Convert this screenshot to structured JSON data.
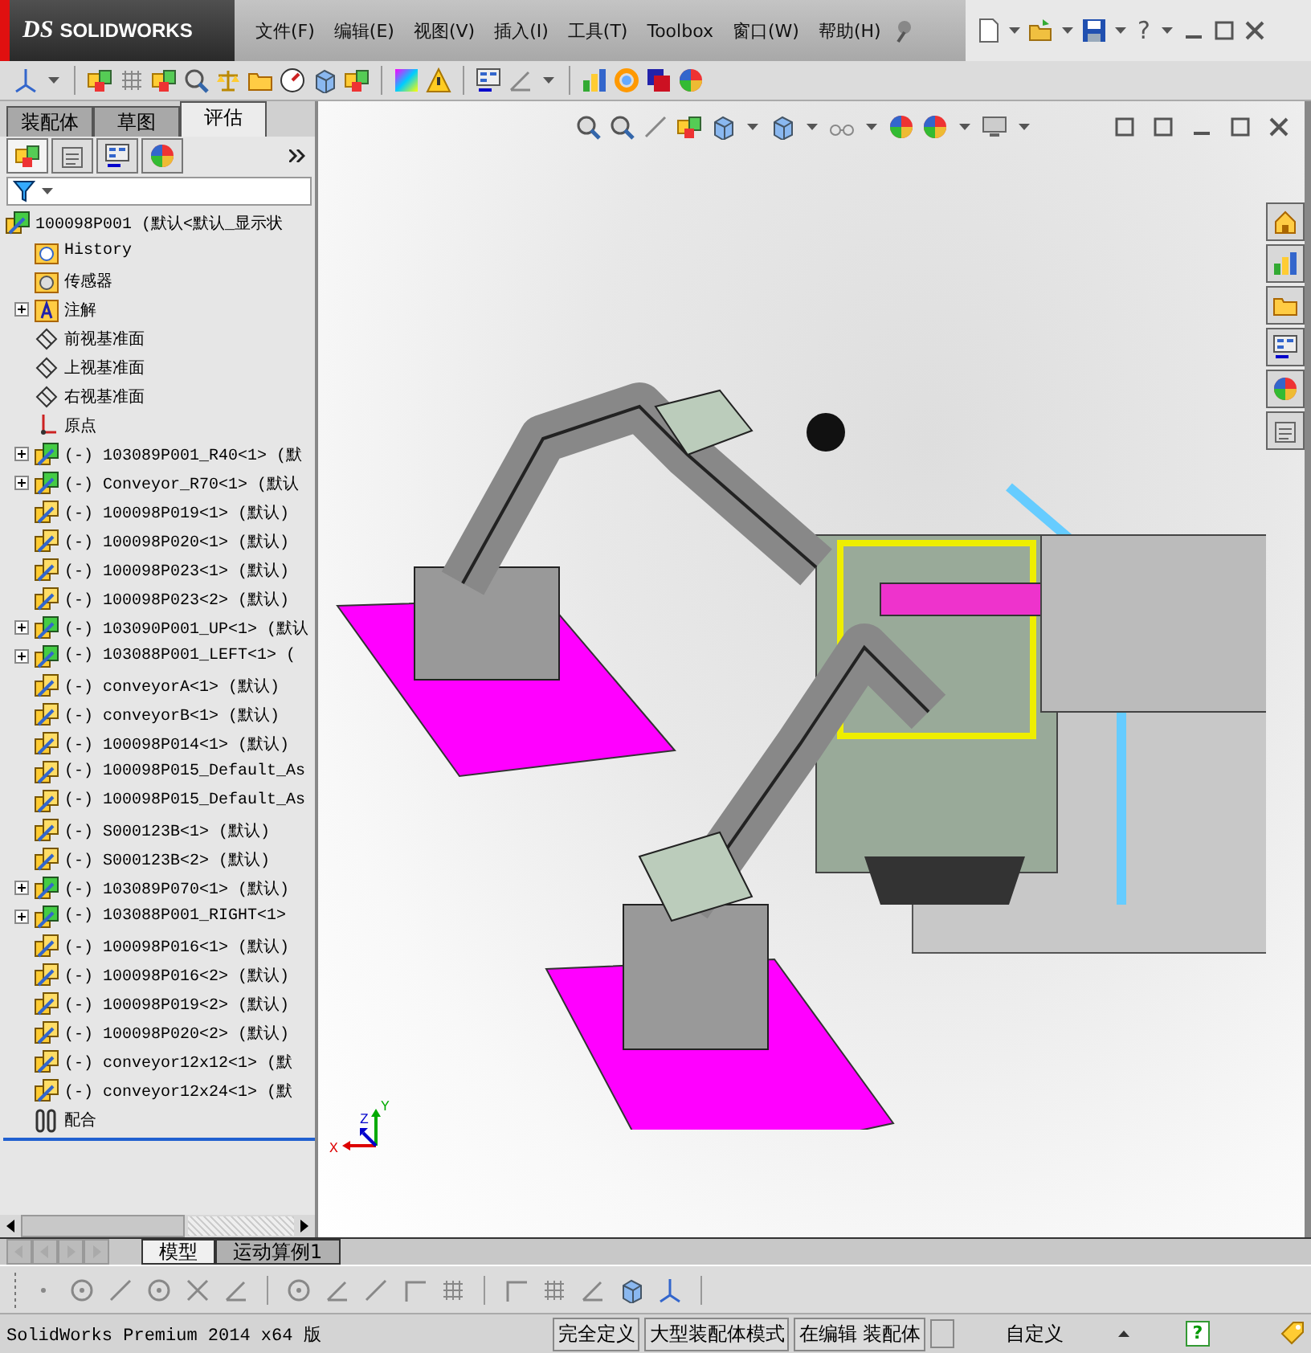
{
  "title_bar": {
    "logo": {
      "mark": "DS",
      "name": "SOLIDWORKS"
    },
    "help": "?"
  },
  "menu": [
    "文件(F)",
    "编辑(E)",
    "视图(V)",
    "插入(I)",
    "工具(T)",
    "Toolbox",
    "窗口(W)",
    "帮助(H)"
  ],
  "feature_manager": {
    "tabs": [
      {
        "label": "装配体",
        "selected": false
      },
      {
        "label": "草图",
        "selected": false
      },
      {
        "label": "评估",
        "selected": true
      }
    ],
    "tree": {
      "label": "100098P001  (默认<默认_显示状",
      "kind": "assembly",
      "children": [
        {
          "label": "History",
          "kind": "history",
          "expandable": false
        },
        {
          "label": "传感器",
          "kind": "sensors",
          "expandable": false
        },
        {
          "label": "注解",
          "kind": "annotations",
          "expandable": true
        },
        {
          "label": "前视基准面",
          "kind": "plane",
          "expandable": false
        },
        {
          "label": "上视基准面",
          "kind": "plane",
          "expandable": false
        },
        {
          "label": "右视基准面",
          "kind": "plane",
          "expandable": false
        },
        {
          "label": "原点",
          "kind": "origin",
          "expandable": false
        },
        {
          "label": "(-) 103089P001_R40<1> (默",
          "kind": "assembly",
          "expandable": true
        },
        {
          "label": "(-) Conveyor_R70<1> (默认",
          "kind": "assembly",
          "expandable": true
        },
        {
          "label": "(-) 100098P019<1> (默认)",
          "kind": "part",
          "expandable": false
        },
        {
          "label": "(-) 100098P020<1> (默认)",
          "kind": "part",
          "expandable": false
        },
        {
          "label": "(-) 100098P023<1> (默认)",
          "kind": "part",
          "expandable": false
        },
        {
          "label": "(-) 100098P023<2> (默认)",
          "kind": "part",
          "expandable": false
        },
        {
          "label": "(-) 103090P001_UP<1> (默认",
          "kind": "assembly",
          "expandable": true
        },
        {
          "label": "(-) 103088P001_LEFT<1> (",
          "kind": "assembly",
          "expandable": true
        },
        {
          "label": "(-) conveyorA<1> (默认)",
          "kind": "part",
          "expandable": false
        },
        {
          "label": "(-) conveyorB<1> (默认)",
          "kind": "part",
          "expandable": false
        },
        {
          "label": "(-) 100098P014<1> (默认)",
          "kind": "part",
          "expandable": false
        },
        {
          "label": "(-) 100098P015_Default_As",
          "kind": "part",
          "expandable": false
        },
        {
          "label": "(-) 100098P015_Default_As",
          "kind": "part",
          "expandable": false
        },
        {
          "label": "(-) S000123B<1> (默认)",
          "kind": "part",
          "expandable": false
        },
        {
          "label": "(-) S000123B<2> (默认)",
          "kind": "part",
          "expandable": false
        },
        {
          "label": "(-) 103089P070<1> (默认)",
          "kind": "assembly",
          "expandable": true
        },
        {
          "label": "(-) 103088P001_RIGHT<1>",
          "kind": "assembly",
          "expandable": true
        },
        {
          "label": "(-) 100098P016<1> (默认)",
          "kind": "part",
          "expandable": false
        },
        {
          "label": "(-) 100098P016<2> (默认)",
          "kind": "part",
          "expandable": false
        },
        {
          "label": "(-) 100098P019<2> (默认)",
          "kind": "part",
          "expandable": false
        },
        {
          "label": "(-) 100098P020<2> (默认)",
          "kind": "part",
          "expandable": false
        },
        {
          "label": "(-) conveyor12x12<1> (默",
          "kind": "part",
          "expandable": false
        },
        {
          "label": "(-) conveyor12x24<1> (默",
          "kind": "part",
          "expandable": false
        },
        {
          "label": "配合",
          "kind": "mates",
          "expandable": false
        }
      ]
    }
  },
  "triad": {
    "x": "X",
    "y": "Y",
    "z": "Z"
  },
  "bottom_tabs": [
    {
      "label": "模型",
      "selected": true
    },
    {
      "label": "运动算例1",
      "selected": false
    }
  ],
  "status_bar": {
    "product": "SolidWorks Premium 2014 x64 版",
    "fields": [
      "完全定义",
      "大型装配体模式",
      "在编辑 装配体"
    ],
    "units": "自定义",
    "help": "?"
  }
}
